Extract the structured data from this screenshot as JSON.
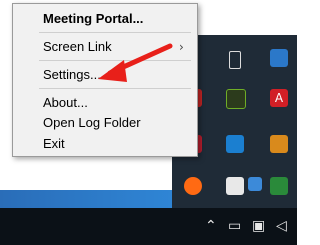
{
  "menu": {
    "items": [
      {
        "label": "Meeting Portal..."
      },
      {
        "label": "Screen Link"
      },
      {
        "label": "Settings..."
      },
      {
        "label": "About..."
      },
      {
        "label": "Open Log Folder"
      },
      {
        "label": "Exit"
      }
    ],
    "submenu_arrow": "›"
  },
  "tray": {
    "icons": [
      "usb-drive-icon",
      "app-blue-icon",
      "mediabox-icon",
      "nvidia-icon",
      "adobe-icon",
      "app-green-icon",
      "remote-app-icon",
      "app-orange-icon",
      "avast-icon",
      "security-shield-icon",
      "network-icon",
      "cloud-icon"
    ]
  },
  "taskbar": {
    "icons": [
      "chevron-up-icon",
      "keyboard-icon",
      "network-icon",
      "speaker-icon"
    ]
  },
  "colors": {
    "arrow": "#e8201a",
    "menu_bg": "#f1f1f1",
    "tray_bg": "#1f2b37"
  }
}
